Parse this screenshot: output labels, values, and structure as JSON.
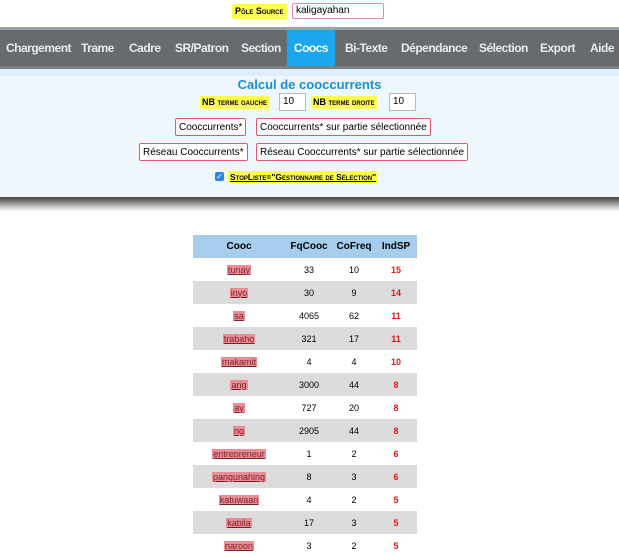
{
  "source": {
    "label": "Pôle Source",
    "value": "kaligayahan"
  },
  "nav": {
    "tabs": [
      {
        "label": "Chargement"
      },
      {
        "label": "Trame"
      },
      {
        "label": "Cadre"
      },
      {
        "label": "SR/Patron"
      },
      {
        "label": "Section"
      },
      {
        "label": "Coocs"
      },
      {
        "label": "Bi-Texte"
      },
      {
        "label": "Dépendance"
      },
      {
        "label": "Sélection"
      },
      {
        "label": "Export"
      },
      {
        "label": "Aide"
      }
    ],
    "active": "Coocs"
  },
  "panel": {
    "title": "Calcul de cooccurrents",
    "left_label": "NB terme gauche",
    "left_value": "10",
    "right_label": "NB terme droite",
    "right_value": "10",
    "btn_coocs": "Cooccurrents*",
    "btn_coocs_sel": "Cooccurrents* sur partie sélectionnée",
    "btn_reseau": "Réseau Cooccurrents*",
    "btn_reseau_sel": "Réseau Cooccurrents* sur partie sélectionnée",
    "stoplist_label": "StopListe=\"Gestionnaire de Sélection\"",
    "stoplist_checked": true
  },
  "table": {
    "headers": [
      "Cooc",
      "FqCooc",
      "CoFreq",
      "IndSP"
    ],
    "rows": [
      [
        "tunay",
        "33",
        "10",
        "15"
      ],
      [
        "inyo",
        "30",
        "9",
        "14"
      ],
      [
        "sa",
        "4065",
        "62",
        "11"
      ],
      [
        "trabaho",
        "321",
        "17",
        "11"
      ],
      [
        "makamit",
        "4",
        "4",
        "10"
      ],
      [
        "ang",
        "3000",
        "44",
        "8"
      ],
      [
        "ay",
        "727",
        "20",
        "8"
      ],
      [
        "ng",
        "2905",
        "44",
        "8"
      ],
      [
        "entrepreneur",
        "1",
        "2",
        "6"
      ],
      [
        "pangunahing",
        "8",
        "3",
        "6"
      ],
      [
        "katuwaan",
        "4",
        "2",
        "5"
      ],
      [
        "kabila",
        "17",
        "3",
        "5"
      ],
      [
        "naroon",
        "3",
        "2",
        "5"
      ]
    ]
  },
  "colors": {
    "accent": "#1aa7ee",
    "nav_bg": "#656b6e",
    "highlight": "#ffff4d",
    "ind": "#e01818",
    "header_bg": "#a6cdee"
  }
}
